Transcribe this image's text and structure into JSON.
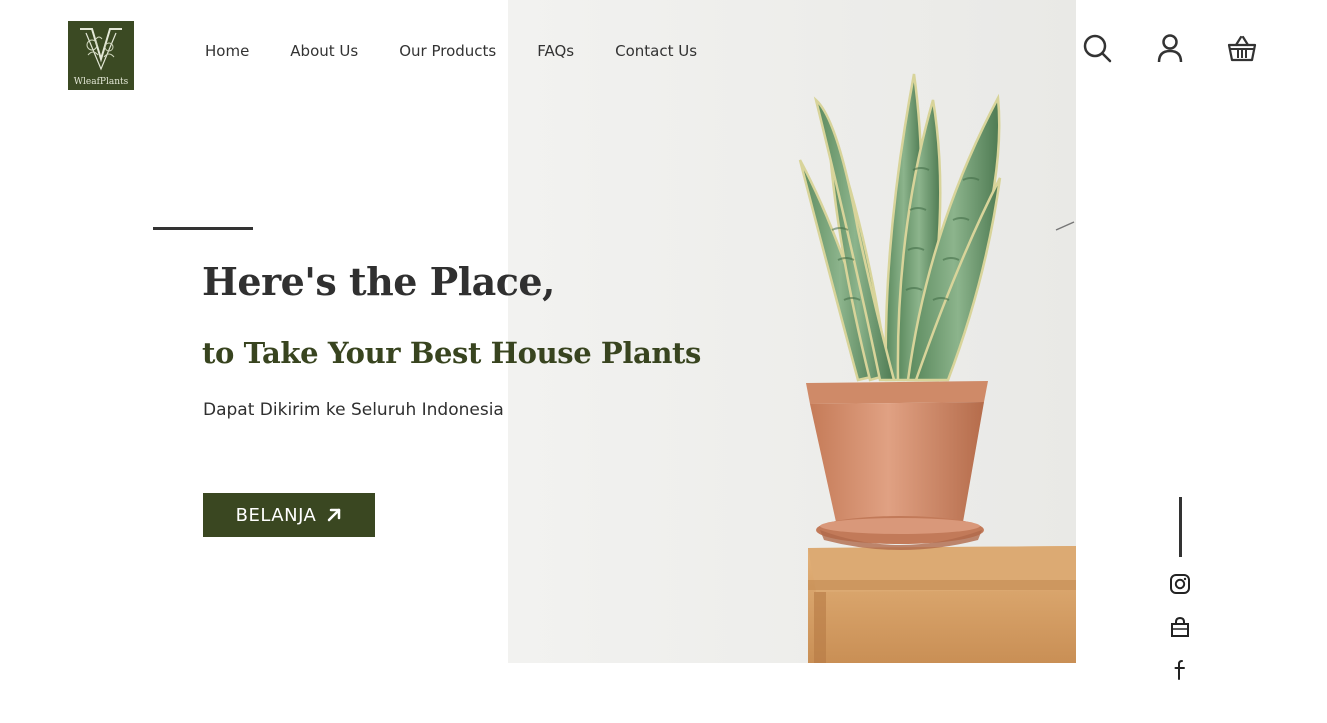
{
  "brand": {
    "name": "WleafPlants",
    "logo_color": "#3b4a23"
  },
  "nav": {
    "items": [
      {
        "label": "Home"
      },
      {
        "label": "About Us"
      },
      {
        "label": "Our Products"
      },
      {
        "label": "FAQs"
      },
      {
        "label": "Contact Us"
      }
    ]
  },
  "header_icons": [
    "search-icon",
    "user-icon",
    "basket-icon"
  ],
  "hero": {
    "headline": "Here's the Place,",
    "subheadline": "to Take Your Best House Plants",
    "tagline": "Dapat Dikirim ke Seluruh Indonesia",
    "cta_label": "BELANJA",
    "cta_icon": "arrow-up-right-icon",
    "image": "snake-plant-in-terracotta-pot",
    "accent_color": "#38441f",
    "button_color": "#3a4721"
  },
  "social": {
    "icons": [
      "instagram-icon",
      "shopping-bag-icon",
      "facebook-icon"
    ]
  }
}
